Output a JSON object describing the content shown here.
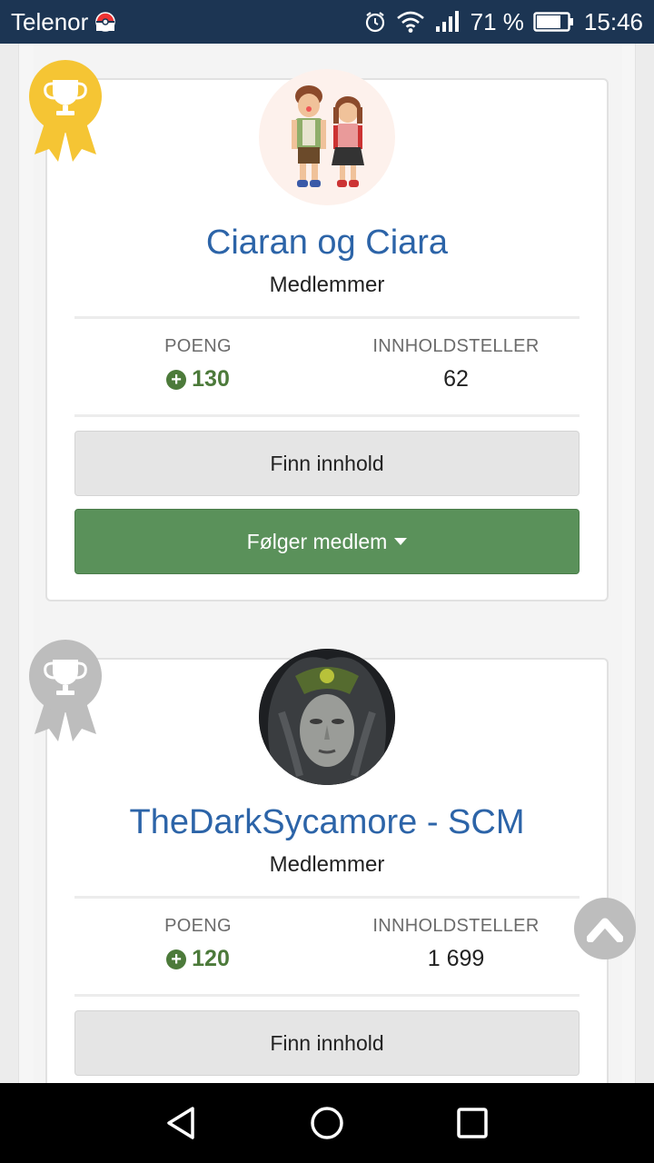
{
  "status_bar": {
    "carrier": "Telenor",
    "battery_percent": "71 %",
    "time": "15:46"
  },
  "members": [
    {
      "rank_icon": "gold-trophy-ribbon",
      "name": "Ciaran og Ciara",
      "group": "Medlemmer",
      "points_label": "POENG",
      "points": "130",
      "content_label": "INNHOLDSTELLER",
      "content_count": "62",
      "find_content_label": "Finn innhold",
      "follow_label": "Følger medlem"
    },
    {
      "rank_icon": "silver-trophy-ribbon",
      "name": "TheDarkSycamore - SCM",
      "group": "Medlemmer",
      "points_label": "POENG",
      "points": "120",
      "content_label": "INNHOLDSTELLER",
      "content_count": "1 699",
      "find_content_label": "Finn innhold"
    }
  ],
  "colors": {
    "status_bar": "#1c3553",
    "name_link": "#2c64a8",
    "points_green": "#4c7a3a",
    "follow_button": "#5a915a",
    "gold": "#f5c534",
    "silver": "#bdbdbd"
  }
}
